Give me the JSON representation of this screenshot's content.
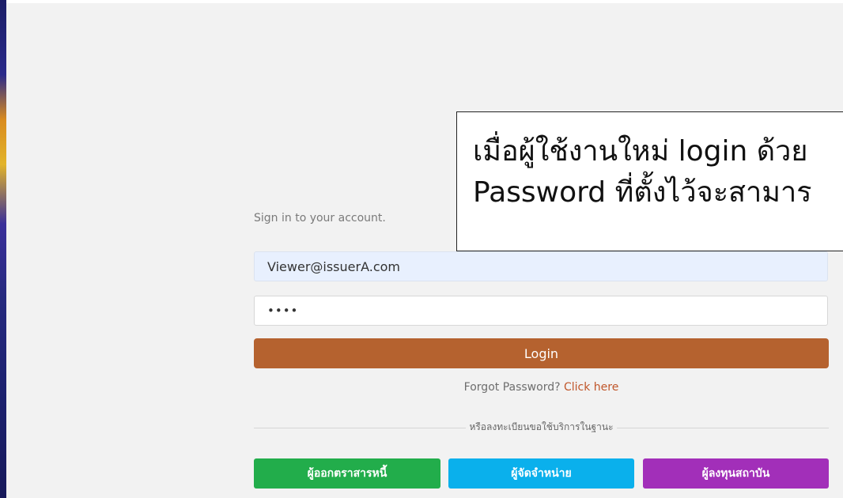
{
  "login": {
    "subtitle": "Sign in to your account.",
    "email_value": "Viewer@issuerA.com",
    "password_masked": "••••",
    "login_label": "Login",
    "forgot_text": "Forgot Password?",
    "forgot_link": "Click here",
    "divider_text": "หรือลงทะเบียนขอใช้บริการในฐานะ"
  },
  "register": {
    "issuer_label": "ผู้ออกตราสารหนี้",
    "distributor_label": "ผู้จัดจำหน่าย",
    "investor_label": "ผู้ลงทุนสถาบัน"
  },
  "overlay": {
    "line1": "เมื่อผู้ใช้งานใหม่ login ด้วย",
    "line2": "Password ที่ตั้งไว้จะสามาร"
  },
  "colors": {
    "login_button": "#b5622f",
    "issuer_button": "#22ad4b",
    "distributor_button": "#0ab0ec",
    "investor_button": "#a22fb9",
    "link": "#c0562a"
  }
}
